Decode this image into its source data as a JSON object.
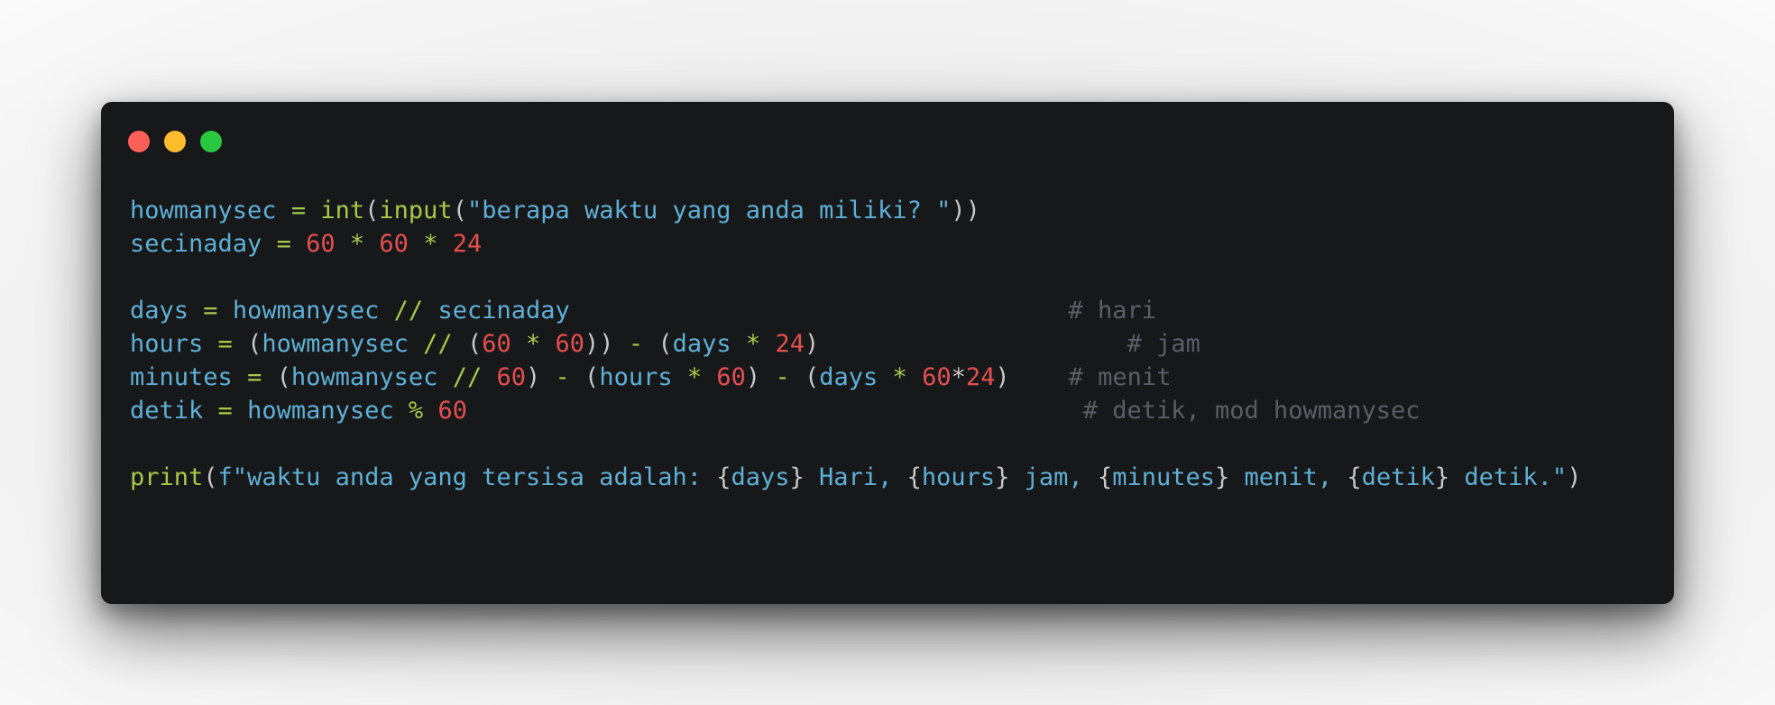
{
  "window": {
    "controls": [
      {
        "name": "close",
        "color": "#fe5f57"
      },
      {
        "name": "minimize",
        "color": "#febc2e"
      },
      {
        "name": "zoom",
        "color": "#29c840"
      }
    ]
  },
  "colors": {
    "var": "#5eb0d6",
    "op": "#a6c94a",
    "num": "#e34f4f",
    "punct": "#c7c7c7",
    "comment": "#595e66"
  },
  "code_lines": [
    {
      "name": "line-1",
      "tokens": [
        {
          "t": "howmanysec",
          "c": "var"
        },
        {
          "t": " ",
          "c": "var"
        },
        {
          "t": "=",
          "c": "op"
        },
        {
          "t": " ",
          "c": "var"
        },
        {
          "t": "int",
          "c": "op"
        },
        {
          "t": "(",
          "c": "punct"
        },
        {
          "t": "input",
          "c": "op"
        },
        {
          "t": "(",
          "c": "punct"
        },
        {
          "t": "\"berapa waktu yang anda miliki? \"",
          "c": "var"
        },
        {
          "t": "))",
          "c": "punct"
        }
      ]
    },
    {
      "name": "line-2",
      "tokens": [
        {
          "t": "secinaday",
          "c": "var"
        },
        {
          "t": " ",
          "c": "var"
        },
        {
          "t": "=",
          "c": "op"
        },
        {
          "t": " ",
          "c": "var"
        },
        {
          "t": "60",
          "c": "num"
        },
        {
          "t": " ",
          "c": "var"
        },
        {
          "t": "*",
          "c": "op"
        },
        {
          "t": " ",
          "c": "var"
        },
        {
          "t": "60",
          "c": "num"
        },
        {
          "t": " ",
          "c": "var"
        },
        {
          "t": "*",
          "c": "op"
        },
        {
          "t": " ",
          "c": "var"
        },
        {
          "t": "24",
          "c": "num"
        }
      ]
    },
    {
      "name": "line-3",
      "tokens": []
    },
    {
      "name": "line-4",
      "tokens": [
        {
          "t": "days",
          "c": "var"
        },
        {
          "t": " ",
          "c": "var"
        },
        {
          "t": "=",
          "c": "op"
        },
        {
          "t": " ",
          "c": "var"
        },
        {
          "t": "howmanysec",
          "c": "var"
        },
        {
          "t": " ",
          "c": "var"
        },
        {
          "t": "//",
          "c": "op"
        },
        {
          "t": " ",
          "c": "var"
        },
        {
          "t": "secinaday",
          "c": "var"
        },
        {
          "t": "                                  ",
          "c": "var"
        },
        {
          "t": "# hari",
          "c": "comment"
        }
      ]
    },
    {
      "name": "line-5",
      "tokens": [
        {
          "t": "hours",
          "c": "var"
        },
        {
          "t": " ",
          "c": "var"
        },
        {
          "t": "=",
          "c": "op"
        },
        {
          "t": " ",
          "c": "var"
        },
        {
          "t": "(",
          "c": "punct"
        },
        {
          "t": "howmanysec",
          "c": "var"
        },
        {
          "t": " ",
          "c": "var"
        },
        {
          "t": "//",
          "c": "op"
        },
        {
          "t": " ",
          "c": "var"
        },
        {
          "t": "(",
          "c": "punct"
        },
        {
          "t": "60",
          "c": "num"
        },
        {
          "t": " ",
          "c": "var"
        },
        {
          "t": "*",
          "c": "op"
        },
        {
          "t": " ",
          "c": "var"
        },
        {
          "t": "60",
          "c": "num"
        },
        {
          "t": "))",
          "c": "punct"
        },
        {
          "t": " ",
          "c": "var"
        },
        {
          "t": "-",
          "c": "op"
        },
        {
          "t": " ",
          "c": "var"
        },
        {
          "t": "(",
          "c": "punct"
        },
        {
          "t": "days",
          "c": "var"
        },
        {
          "t": " ",
          "c": "var"
        },
        {
          "t": "*",
          "c": "op"
        },
        {
          "t": " ",
          "c": "var"
        },
        {
          "t": "24",
          "c": "num"
        },
        {
          "t": ")",
          "c": "punct"
        },
        {
          "t": "                     ",
          "c": "var"
        },
        {
          "t": "# jam",
          "c": "comment"
        }
      ]
    },
    {
      "name": "line-6",
      "tokens": [
        {
          "t": "minutes",
          "c": "var"
        },
        {
          "t": " ",
          "c": "var"
        },
        {
          "t": "=",
          "c": "op"
        },
        {
          "t": " ",
          "c": "var"
        },
        {
          "t": "(",
          "c": "punct"
        },
        {
          "t": "howmanysec",
          "c": "var"
        },
        {
          "t": " ",
          "c": "var"
        },
        {
          "t": "//",
          "c": "op"
        },
        {
          "t": " ",
          "c": "var"
        },
        {
          "t": "60",
          "c": "num"
        },
        {
          "t": ")",
          "c": "punct"
        },
        {
          "t": " ",
          "c": "var"
        },
        {
          "t": "-",
          "c": "op"
        },
        {
          "t": " ",
          "c": "var"
        },
        {
          "t": "(",
          "c": "punct"
        },
        {
          "t": "hours",
          "c": "var"
        },
        {
          "t": " ",
          "c": "var"
        },
        {
          "t": "*",
          "c": "op"
        },
        {
          "t": " ",
          "c": "var"
        },
        {
          "t": "60",
          "c": "num"
        },
        {
          "t": ")",
          "c": "punct"
        },
        {
          "t": " ",
          "c": "var"
        },
        {
          "t": "-",
          "c": "op"
        },
        {
          "t": " ",
          "c": "var"
        },
        {
          "t": "(",
          "c": "punct"
        },
        {
          "t": "days",
          "c": "var"
        },
        {
          "t": " ",
          "c": "var"
        },
        {
          "t": "*",
          "c": "op"
        },
        {
          "t": " ",
          "c": "var"
        },
        {
          "t": "60",
          "c": "num"
        },
        {
          "t": "*",
          "c": "punct"
        },
        {
          "t": "24",
          "c": "num"
        },
        {
          "t": ")",
          "c": "punct"
        },
        {
          "t": "    ",
          "c": "var"
        },
        {
          "t": "# menit",
          "c": "comment"
        }
      ]
    },
    {
      "name": "line-7",
      "tokens": [
        {
          "t": "detik",
          "c": "var"
        },
        {
          "t": " ",
          "c": "var"
        },
        {
          "t": "=",
          "c": "op"
        },
        {
          "t": " ",
          "c": "var"
        },
        {
          "t": "howmanysec",
          "c": "var"
        },
        {
          "t": " ",
          "c": "var"
        },
        {
          "t": "%",
          "c": "op"
        },
        {
          "t": " ",
          "c": "var"
        },
        {
          "t": "60",
          "c": "num"
        },
        {
          "t": "                                          ",
          "c": "var"
        },
        {
          "t": "# detik, mod howmanysec",
          "c": "comment"
        }
      ]
    },
    {
      "name": "line-8",
      "tokens": []
    },
    {
      "name": "line-9",
      "tokens": [
        {
          "t": "print",
          "c": "op"
        },
        {
          "t": "(",
          "c": "punct"
        },
        {
          "t": "f\"waktu anda yang tersisa adalah: ",
          "c": "var"
        },
        {
          "t": "{",
          "c": "punct"
        },
        {
          "t": "days",
          "c": "var"
        },
        {
          "t": "}",
          "c": "punct"
        },
        {
          "t": " Hari, ",
          "c": "var"
        },
        {
          "t": "{",
          "c": "punct"
        },
        {
          "t": "hours",
          "c": "var"
        },
        {
          "t": "}",
          "c": "punct"
        },
        {
          "t": " jam, ",
          "c": "var"
        },
        {
          "t": "{",
          "c": "punct"
        },
        {
          "t": "minutes",
          "c": "var"
        },
        {
          "t": "}",
          "c": "punct"
        },
        {
          "t": " menit, ",
          "c": "var"
        },
        {
          "t": "{",
          "c": "punct"
        },
        {
          "t": "detik",
          "c": "var"
        },
        {
          "t": "}",
          "c": "punct"
        },
        {
          "t": " detik.\"",
          "c": "var"
        },
        {
          "t": ")",
          "c": "punct"
        }
      ]
    }
  ]
}
